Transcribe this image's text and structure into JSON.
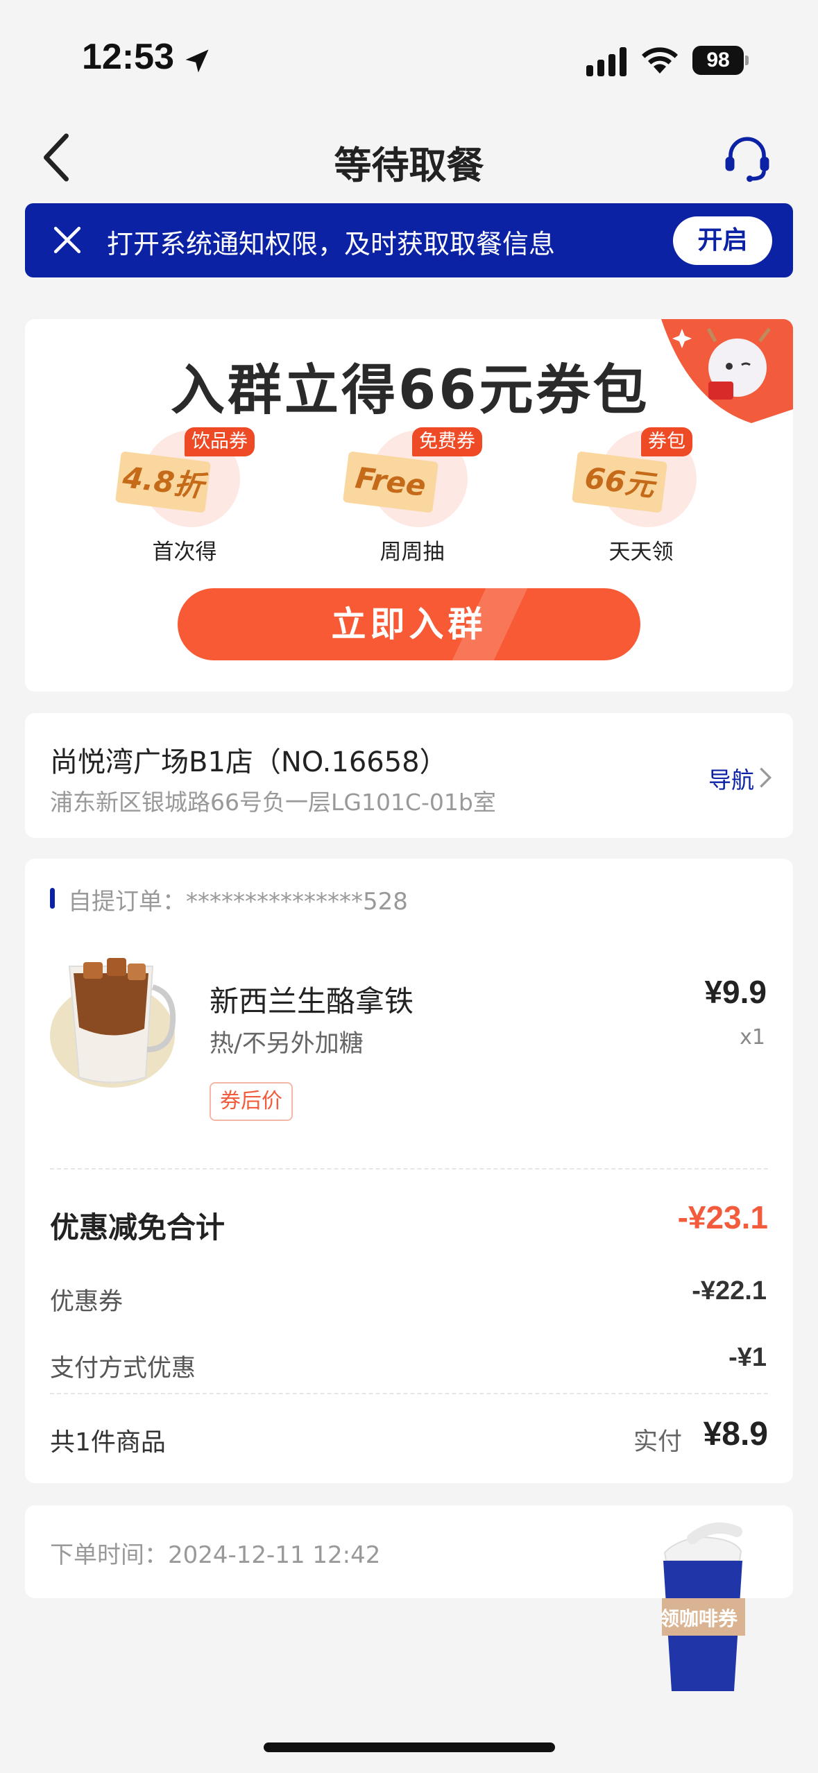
{
  "status_bar": {
    "time": "12:53",
    "battery": "98"
  },
  "nav": {
    "title": "等待取餐"
  },
  "notice": {
    "text": "打开系统通知权限，及时获取取餐信息",
    "button": "开启"
  },
  "promo": {
    "title": "入群立得66元券包",
    "perks": [
      {
        "badge": "饮品券",
        "ticket": "4.8折",
        "label": "首次得"
      },
      {
        "badge": "免费券",
        "ticket": "Free",
        "label": "周周抽"
      },
      {
        "badge": "券包",
        "ticket": "66元",
        "label": "天天领"
      }
    ],
    "button": "立即入群"
  },
  "store": {
    "name": "尚悦湾广场B1店（NO.16658）",
    "address": "浦东新区银城路66号负一层LG101C-01b室",
    "nav_label": "导航"
  },
  "order": {
    "label": "自提订单：***************528",
    "item": {
      "name": "新西兰生酪拿铁",
      "spec": "热/不另外加糖",
      "tag": "券后价",
      "price": "¥9.9",
      "qty": "x1"
    },
    "discount_title": "优惠减免合计",
    "discount_total": "-¥23.1",
    "rows": [
      {
        "label": "优惠券",
        "value": "-¥22.1"
      },
      {
        "label": "支付方式优惠",
        "value": "-¥1"
      }
    ],
    "count_label": "共1件商品",
    "paid_label": "实付",
    "paid_value": "¥8.9"
  },
  "order_time": "下单时间：2024-12-11 12:42",
  "float_coupon": "领咖啡券",
  "colors": {
    "brand_blue": "#0b22a5",
    "accent_orange": "#f85a35",
    "discount_red": "#f25c3d"
  }
}
